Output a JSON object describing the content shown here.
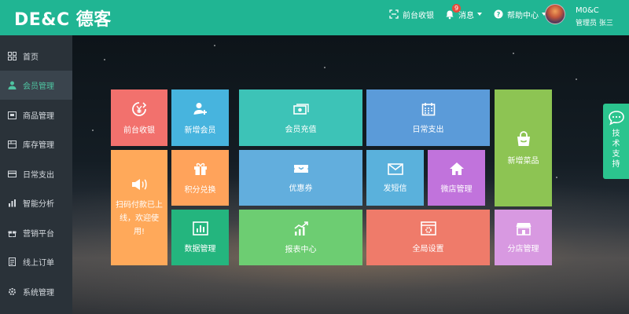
{
  "header": {
    "logo": "DE&C 德客",
    "cashier": "前台收银",
    "messages": "消息",
    "message_count": "9",
    "help": "帮助中心",
    "user_name": "M0&C",
    "user_role": "管理员  张三",
    "icons": [
      "scan-icon",
      "bell-icon",
      "help-icon",
      "avatar"
    ]
  },
  "sidebar": {
    "items": [
      {
        "label": "首页",
        "icon": "grid-icon"
      },
      {
        "label": "会员管理",
        "icon": "user-icon",
        "active": true
      },
      {
        "label": "商品管理",
        "icon": "box-icon"
      },
      {
        "label": "库存管理",
        "icon": "warehouse-icon"
      },
      {
        "label": "日常支出",
        "icon": "card-icon"
      },
      {
        "label": "智能分析",
        "icon": "bar-chart-icon"
      },
      {
        "label": "营销平台",
        "icon": "gift-icon"
      },
      {
        "label": "线上订单",
        "icon": "order-icon"
      },
      {
        "label": "系统管理",
        "icon": "gear-icon"
      }
    ]
  },
  "tiles": {
    "cashier": {
      "label": "前台收银",
      "color": "#f2716d",
      "icon": "yen-cycle-icon"
    },
    "add_member": {
      "label": "新增会员",
      "color": "#47b4de",
      "icon": "add-user-icon"
    },
    "recharge": {
      "label": "会员充值",
      "color": "#3dc3b7",
      "icon": "money-icon"
    },
    "expense": {
      "label": "日常支出",
      "color": "#5b9bd9",
      "icon": "calendar-icon"
    },
    "new_dish": {
      "label": "新增菜品",
      "color": "#8dc453",
      "icon": "bag-icon"
    },
    "notice": {
      "label": "扫码付款已上线，欢迎使用!",
      "color": "#ffa95a",
      "icon": "speaker-icon"
    },
    "points": {
      "label": "积分兑换",
      "color": "#ffa35b",
      "icon": "gift-box-icon"
    },
    "coupon": {
      "label": "优惠券",
      "color": "#62aedd",
      "icon": "ticket-icon"
    },
    "sms": {
      "label": "发短信",
      "color": "#5ab1dc",
      "icon": "mail-icon"
    },
    "shop": {
      "label": "微店管理",
      "color": "#c173dc",
      "icon": "home-icon"
    },
    "data": {
      "label": "数据管理",
      "color": "#24b57e",
      "icon": "chart-board-icon"
    },
    "report": {
      "label": "报表中心",
      "color": "#6dcd72",
      "icon": "trend-icon"
    },
    "settings": {
      "label": "全局设置",
      "color": "#ef7b6a",
      "icon": "settings-board-icon"
    },
    "branch": {
      "label": "分店管理",
      "color": "#d899e1",
      "icon": "store-icon"
    }
  },
  "support": {
    "label": "技术支持",
    "icon": "chat-icon"
  }
}
